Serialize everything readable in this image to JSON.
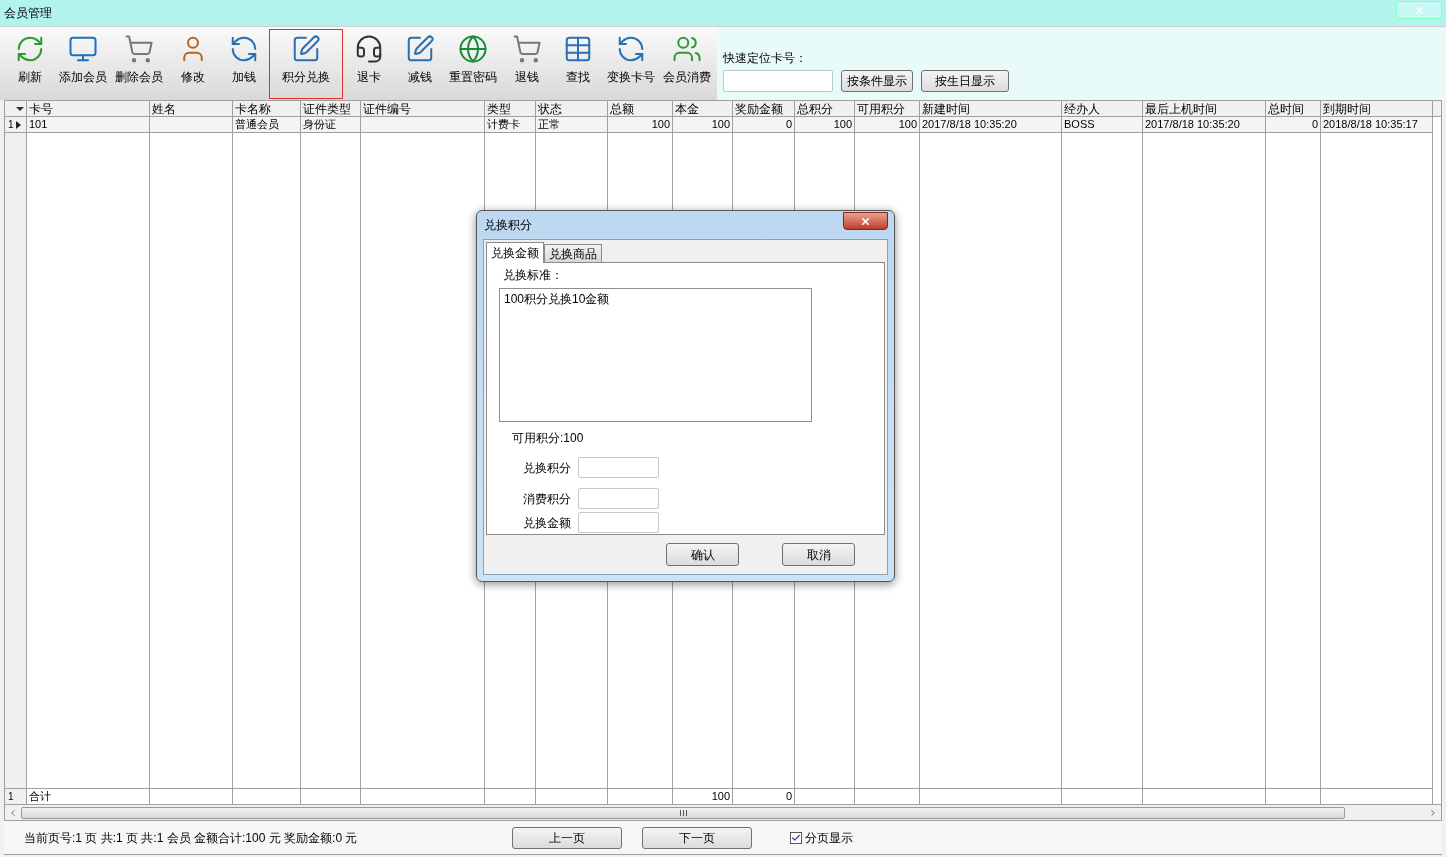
{
  "window": {
    "title": "会员管理"
  },
  "toolbar": {
    "items": [
      {
        "label": "刷新",
        "selected": false
      },
      {
        "label": "添加会员",
        "selected": false
      },
      {
        "label": "删除会员",
        "selected": false
      },
      {
        "label": "修改",
        "selected": false
      },
      {
        "label": "加钱",
        "selected": false
      },
      {
        "label": "积分兑换",
        "selected": true
      },
      {
        "label": "退卡",
        "selected": false
      },
      {
        "label": "减钱",
        "selected": false
      },
      {
        "label": "重置密码",
        "selected": false
      },
      {
        "label": "退钱",
        "selected": false
      },
      {
        "label": "查找",
        "selected": false
      },
      {
        "label": "变换卡号",
        "selected": false
      },
      {
        "label": "会员消费",
        "selected": false
      }
    ],
    "quick_locate": {
      "label": "快速定位卡号："
    },
    "buttons": [
      "按条件显示",
      "按生日显示"
    ]
  },
  "table": {
    "columns": [
      {
        "label": "卡号",
        "kind": "text"
      },
      {
        "label": "姓名",
        "kind": "text"
      },
      {
        "label": "卡名称",
        "kind": "text"
      },
      {
        "label": "证件类型",
        "kind": "text"
      },
      {
        "label": "证件编号",
        "kind": "text"
      },
      {
        "label": "类型",
        "kind": "text"
      },
      {
        "label": "状态",
        "kind": "text"
      },
      {
        "label": "总额",
        "kind": "number"
      },
      {
        "label": "本金",
        "kind": "number"
      },
      {
        "label": "奖励金额",
        "kind": "number"
      },
      {
        "label": "总积分",
        "kind": "number"
      },
      {
        "label": "可用积分",
        "kind": "number"
      },
      {
        "label": "新建时间",
        "kind": "text"
      },
      {
        "label": "经办人",
        "kind": "text"
      },
      {
        "label": "最后上机时间",
        "kind": "text"
      },
      {
        "label": "总时间",
        "kind": "number"
      },
      {
        "label": "到期时间",
        "kind": "text"
      }
    ],
    "rows": [
      {
        "row_number": "1",
        "current": true,
        "cells": [
          "101",
          null,
          "普通会员",
          "身份证",
          null,
          "计费卡",
          "正常",
          "100",
          "100",
          "0",
          "100",
          "100",
          "2017/8/18 10:35:20",
          "BOSS",
          "2017/8/18 10:35:20",
          "0",
          "2018/8/18 10:35:17"
        ]
      }
    ],
    "footer": {
      "row_number": "1",
      "cells": [
        "合计",
        null,
        null,
        null,
        null,
        null,
        null,
        null,
        "100",
        "0",
        null,
        null,
        null,
        null,
        null,
        null,
        null
      ]
    }
  },
  "status_bar": {
    "text": "当前页号:1 页 共:1 页 共:1 会员 金额合计:100 元 奖励金额:0 元",
    "buttons": [
      "上一页",
      "下一页"
    ],
    "paging": {
      "label": "分页显示",
      "checked": true
    }
  },
  "dialog": {
    "title": "兑换积分",
    "tabs": [
      {
        "label": "兑换金额",
        "selected": true
      },
      {
        "label": "兑换商品",
        "selected": false
      }
    ],
    "standard_label": "兑换标准：",
    "standard_text": "100积分兑换10金额",
    "available_points": "可用积分:100",
    "fields": [
      {
        "label": "兑换积分"
      },
      {
        "label": "消费积分"
      },
      {
        "label": "兑换金额"
      }
    ],
    "buttons": [
      "确认",
      "取消"
    ]
  }
}
